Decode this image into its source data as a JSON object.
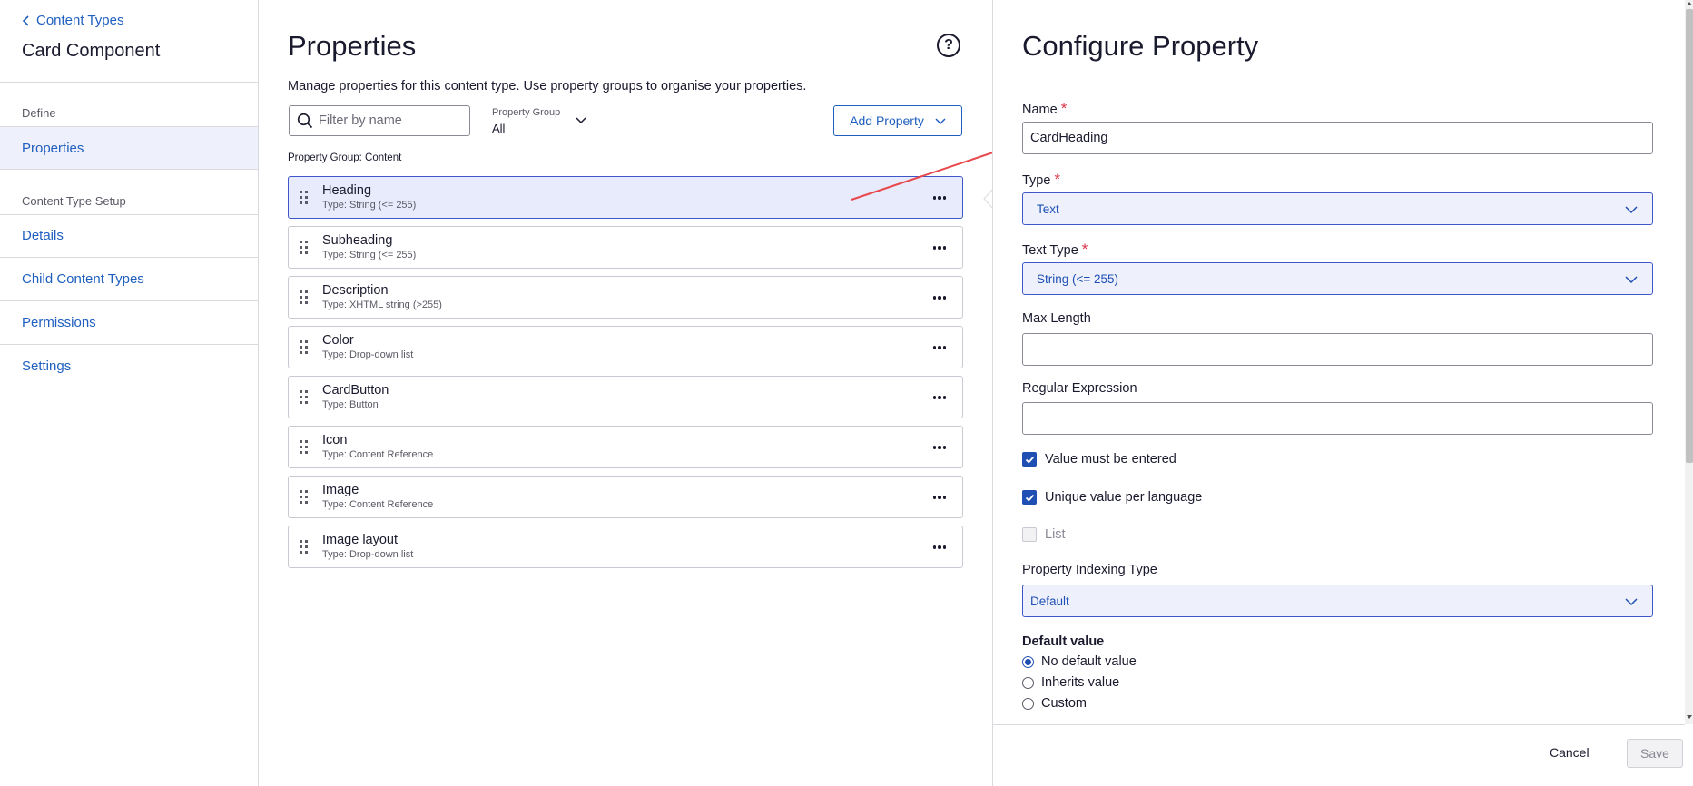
{
  "sidebar": {
    "back_label": "Content Types",
    "title": "Card Component",
    "section_define": "Define",
    "section_setup": "Content Type Setup",
    "items": [
      {
        "label": "Properties"
      },
      {
        "label": "Details"
      },
      {
        "label": "Child Content Types"
      },
      {
        "label": "Permissions"
      },
      {
        "label": "Settings"
      }
    ]
  },
  "main": {
    "title": "Properties",
    "help_icon": "question-circle-icon",
    "description": "Manage properties for this content type. Use property groups to organise your properties.",
    "filter": {
      "placeholder": "Filter by name",
      "value": ""
    },
    "property_group": {
      "label": "Property Group",
      "value": "All"
    },
    "add_property_label": "Add Property",
    "group_label": "Property Group: Content",
    "properties": [
      {
        "name": "Heading",
        "type": "Type: String (<= 255)",
        "selected": true
      },
      {
        "name": "Subheading",
        "type": "Type: String (<= 255)"
      },
      {
        "name": "Description",
        "type": "Type: XHTML string (>255)"
      },
      {
        "name": "Color",
        "type": "Type: Drop-down list"
      },
      {
        "name": "CardButton",
        "type": "Type: Button"
      },
      {
        "name": "Icon",
        "type": "Type: Content Reference"
      },
      {
        "name": "Image",
        "type": "Type: Content Reference"
      },
      {
        "name": "Image layout",
        "type": "Type: Drop-down list"
      }
    ]
  },
  "configure": {
    "title": "Configure Property",
    "name_label": "Name",
    "name_value": "CardHeading",
    "type_label": "Type",
    "type_value": "Text",
    "text_type_label": "Text Type",
    "text_type_value": "String (<= 255)",
    "required_mark": "*",
    "max_length_label": "Max Length",
    "max_length_value": "",
    "regex_label": "Regular Expression",
    "regex_value": "",
    "checkboxes": [
      {
        "label": "Value must be entered",
        "checked": true
      },
      {
        "label": "Unique value per language",
        "checked": true
      },
      {
        "label": "List",
        "checked": false,
        "disabled": true
      }
    ],
    "indexing_label": "Property Indexing Type",
    "indexing_value": "Default",
    "default_value_label": "Default value",
    "default_options": [
      {
        "label": "No default value",
        "selected": true
      },
      {
        "label": "Inherits value",
        "selected": false
      },
      {
        "label": "Custom",
        "selected": false
      }
    ],
    "cancel_label": "Cancel",
    "save_label": "Save"
  },
  "colors": {
    "accent": "#1f5fbf",
    "selected_row_bg": "#e8ebfb",
    "required": "#d9344b",
    "annotation_arrow": "#e8474c"
  }
}
